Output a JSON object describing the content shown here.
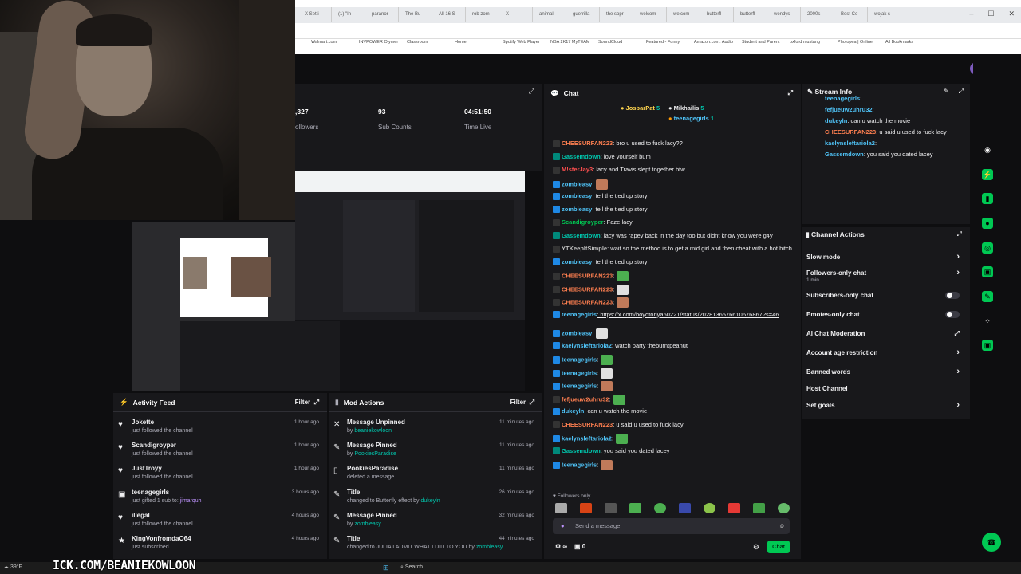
{
  "overlay": {
    "url_text": "ICK.COM/BEANIEKOWLOON"
  },
  "browser": {
    "tabs": [
      "X Setti",
      "(1) \"In",
      "paranor",
      "The Bu",
      "All 16 S",
      "rob zom",
      "X",
      "animal",
      "guerrilla",
      "the sopr",
      "welcom",
      "welcom",
      "butterfl",
      "butterfl",
      "wendys",
      "2000s",
      "Best Co",
      "wojak s"
    ],
    "bookmarks": [
      "Walmart.com",
      "INVPOWER Olymer",
      "Classroom",
      "Home",
      "Spotify Web Player",
      "NBA 2K17 MyTEAM",
      "SoundCloud",
      "Featured - Funny",
      "Amazon.com: Audib",
      "Student and Parent",
      "oxford mustang",
      "Photopea | Online",
      "All Bookmarks"
    ]
  },
  "stats": [
    {
      "value": ",327",
      "label": "ollowers"
    },
    {
      "value": "93",
      "label": "Sub Counts"
    },
    {
      "value": "04:51:50",
      "label": "Time Live"
    }
  ],
  "activity_feed": {
    "title": "Activity Feed",
    "filter_label": "Filter",
    "items": [
      {
        "name": "Jokette",
        "sub": "just followed the channel",
        "time": "1 hour ago"
      },
      {
        "name": "Scandigroyper",
        "sub": "just followed the channel",
        "time": "1 hour ago"
      },
      {
        "name": "JustTroyy",
        "sub": "just followed the channel",
        "time": "1 hour ago"
      },
      {
        "name": "teenagegirls",
        "sub_prefix": "just gifted 1 sub to: ",
        "sub_target": "jimarquh",
        "time": "3 hours ago"
      },
      {
        "name": "illegal",
        "sub": "just followed the channel",
        "time": "4 hours ago"
      },
      {
        "name": "KingVonfromdaO64",
        "sub": "just subscribed",
        "time": "4 hours ago"
      }
    ]
  },
  "mod_actions": {
    "title": "Mod Actions",
    "filter_label": "Filter",
    "items": [
      {
        "name": "Message Unpinned",
        "prefix": "by ",
        "target": "beaniekowloon",
        "time": "11 minutes ago"
      },
      {
        "name": "Message Pinned",
        "prefix": "by ",
        "target": "PookiesParadise",
        "time": "11 minutes ago"
      },
      {
        "name": "PookiesParadise",
        "prefix": "deleted a message",
        "target": "",
        "time": "11 minutes ago"
      },
      {
        "name": "Title",
        "prefix": "changed to Butterfly effect by ",
        "target": "dukeyln",
        "time": "26 minutes ago"
      },
      {
        "name": "Message Pinned",
        "prefix": "by ",
        "target": "zombieasy",
        "time": "32 minutes ago"
      },
      {
        "name": "Title",
        "prefix": "changed to JULIA I ADMIT WHAT I DID TO YOU by ",
        "target": "zombieasy",
        "time": "44 minutes ago"
      }
    ]
  },
  "chat": {
    "title": "Chat",
    "leaderboard": [
      {
        "name": "JosbarPat",
        "count": "5"
      },
      {
        "name": "Mikhailis",
        "count": "5"
      },
      {
        "name": "teenagegirls",
        "count": "1"
      }
    ],
    "messages": [
      {
        "user": "CHEESURFAN223",
        "color": "#ff7f50",
        "text": ": bro u used to fuck lacy??"
      },
      {
        "user": "Gassemdown",
        "color": "#00c8af",
        "text": ": love yourself bum"
      },
      {
        "user": "M!sterJay3",
        "color": "#ff4f4f",
        "text": ": lacy and Travis slept together btw"
      },
      {
        "user": "zombieasy",
        "color": "#4fc3f7",
        "text": ":"
      },
      {
        "user": "zombieasy",
        "color": "#4fc3f7",
        "text": ": tell the tied up story"
      },
      {
        "user": "zombieasy",
        "color": "#4fc3f7",
        "text": ": tell the tied up story"
      },
      {
        "user": "Scandigroyper",
        "color": "#00c853",
        "text": ": Faze lacy"
      },
      {
        "user": "Gassemdown",
        "color": "#00c8af",
        "text": ": lacy was rapey back in the day too but didnt know you were g4y"
      },
      {
        "user": "YTKeepItSimple",
        "color": "#bdbdbd",
        "text": ": wait so the method is to get a mid girl and then cheat with a hot bitch"
      },
      {
        "user": "zombieasy",
        "color": "#4fc3f7",
        "text": ": tell the tied up story"
      },
      {
        "user": "CHEESURFAN223",
        "color": "#ff7f50",
        "text": ":"
      },
      {
        "user": "CHEESURFAN223",
        "color": "#ff7f50",
        "text": ":"
      },
      {
        "user": "CHEESURFAN223",
        "color": "#ff7f50",
        "text": ":"
      },
      {
        "user": "teenagegirls",
        "color": "#4fc3f7",
        "text": ": https://x.com/boydtonya60221/status/2028136576610676867?s=46"
      },
      {
        "user": "zombieasy",
        "color": "#4fc3f7",
        "text": ":"
      },
      {
        "user": "kaelynsleftariola2",
        "color": "#4fc3f7",
        "text": ": watch party theburntpeanut"
      },
      {
        "user": "teenagegirls",
        "color": "#4fc3f7",
        "text": ":"
      },
      {
        "user": "teenagegirls",
        "color": "#4fc3f7",
        "text": ":"
      },
      {
        "user": "teenagegirls",
        "color": "#4fc3f7",
        "text": ":"
      },
      {
        "user": "fefjueuw2uhru32",
        "color": "#ff7f50",
        "text": ":"
      },
      {
        "user": "dukeyln",
        "color": "#4fc3f7",
        "text": ": can u watch the movie"
      },
      {
        "user": "CHEESURFAN223",
        "color": "#ff7f50",
        "text": ": u said u used to fuck lacy"
      },
      {
        "user": "kaelynsleftariola2",
        "color": "#4fc3f7",
        "text": ":"
      },
      {
        "user": "Gassemdown",
        "color": "#00c8af",
        "text": ": you said you dated lacey"
      },
      {
        "user": "teenagegirls",
        "color": "#4fc3f7",
        "text": ":"
      }
    ],
    "followers_only": "Followers only",
    "placeholder": "Send a message",
    "count": "0",
    "send_label": "Chat"
  },
  "stream_info": {
    "title": "Stream Info",
    "overlay_lines": [
      {
        "user": "teenagegirls",
        "text": ":"
      },
      {
        "user": "fefjueuw2uhru32",
        "text": ":"
      },
      {
        "user": "dukeyln",
        "text": ": can u watch the movie"
      },
      {
        "user": "CHEESURFAN223",
        "text": ": u said u used to fuck lacy"
      },
      {
        "user": "kaelynsleftariola2",
        "text": ":"
      },
      {
        "user": "Gassemdown",
        "text": ": you said you dated lacey"
      }
    ]
  },
  "channel_actions": {
    "title": "Channel Actions",
    "items": [
      {
        "label": "Slow mode",
        "control": "chevron"
      },
      {
        "label": "Followers-only chat",
        "sub": "1 min",
        "control": "chevron"
      },
      {
        "label": "Subscribers-only chat",
        "control": "toggle"
      },
      {
        "label": "Emotes-only chat",
        "control": "toggle"
      },
      {
        "label": "AI Chat Moderation",
        "control": "external"
      },
      {
        "label": "Account age restriction",
        "control": "chevron"
      },
      {
        "label": "Banned words",
        "control": "chevron"
      },
      {
        "label": "Host Channel",
        "control": "none"
      },
      {
        "label": "Set goals",
        "control": "chevron"
      }
    ]
  },
  "taskbar": {
    "search": "Search",
    "temp": "39°F"
  }
}
